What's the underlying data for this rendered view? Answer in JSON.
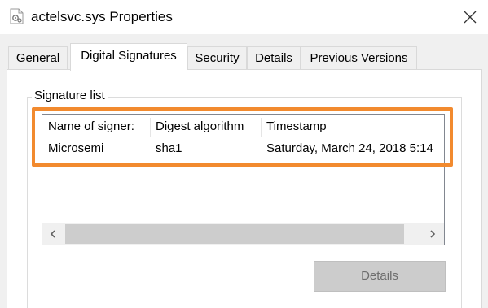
{
  "window": {
    "title": "actelsvc.sys Properties",
    "file_icon": "system-file-icon",
    "close_icon": "close-icon"
  },
  "tabs": [
    {
      "label": "General",
      "active": false
    },
    {
      "label": "Digital Signatures",
      "active": true
    },
    {
      "label": "Security",
      "active": false
    },
    {
      "label": "Details",
      "active": false
    },
    {
      "label": "Previous Versions",
      "active": false
    }
  ],
  "signature_list": {
    "group_label": "Signature list",
    "columns": [
      "Name of signer:",
      "Digest algorithm",
      "Timestamp"
    ],
    "rows": [
      [
        "Microsemi",
        "sha1",
        "Saturday, March 24, 2018 5:14"
      ]
    ]
  },
  "scrollbar": {
    "left_icon": "chevron-left-icon",
    "right_icon": "chevron-right-icon"
  },
  "buttons": {
    "details_label": "Details",
    "details_enabled": false
  },
  "colors": {
    "highlight": "#f28a2e",
    "panel": "#ffffff",
    "window_bg": "#f0f0f0"
  }
}
